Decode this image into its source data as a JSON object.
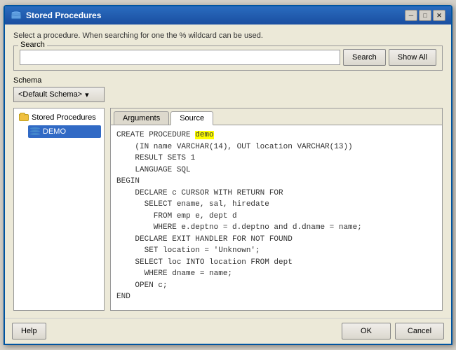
{
  "window": {
    "title": "Stored Procedures",
    "icon": "database-icon"
  },
  "description": "Select a procedure. When searching for one the % wildcard can be used.",
  "search": {
    "label": "Search",
    "placeholder": "",
    "value": "",
    "search_btn": "Search",
    "show_all_btn": "Show All"
  },
  "schema": {
    "label": "Schema",
    "value": "<Default Schema>"
  },
  "tree": {
    "root_label": "Stored Procedures",
    "child_label": "DEMO"
  },
  "tabs": [
    {
      "label": "Arguments",
      "active": false
    },
    {
      "label": "Source",
      "active": true
    }
  ],
  "source_code": "CREATE PROCEDURE {demo}\n    (IN name VARCHAR(14), OUT location VARCHAR(13))\n    RESULT SETS 1\n    LANGUAGE SQL\nBEGIN\n    DECLARE c CURSOR WITH RETURN FOR\n      SELECT ename, sal, hiredate\n        FROM emp e, dept d\n        WHERE e.deptno = d.deptno and d.dname = name;\n    DECLARE EXIT HANDLER FOR NOT FOUND\n      SET location = 'Unknown';\n    SELECT loc INTO location FROM dept\n      WHERE dname = name;\n    OPEN c;\nEND",
  "buttons": {
    "help": "Help",
    "ok": "OK",
    "cancel": "Cancel"
  },
  "title_buttons": {
    "minimize": "─",
    "maximize": "□",
    "close": "✕"
  }
}
